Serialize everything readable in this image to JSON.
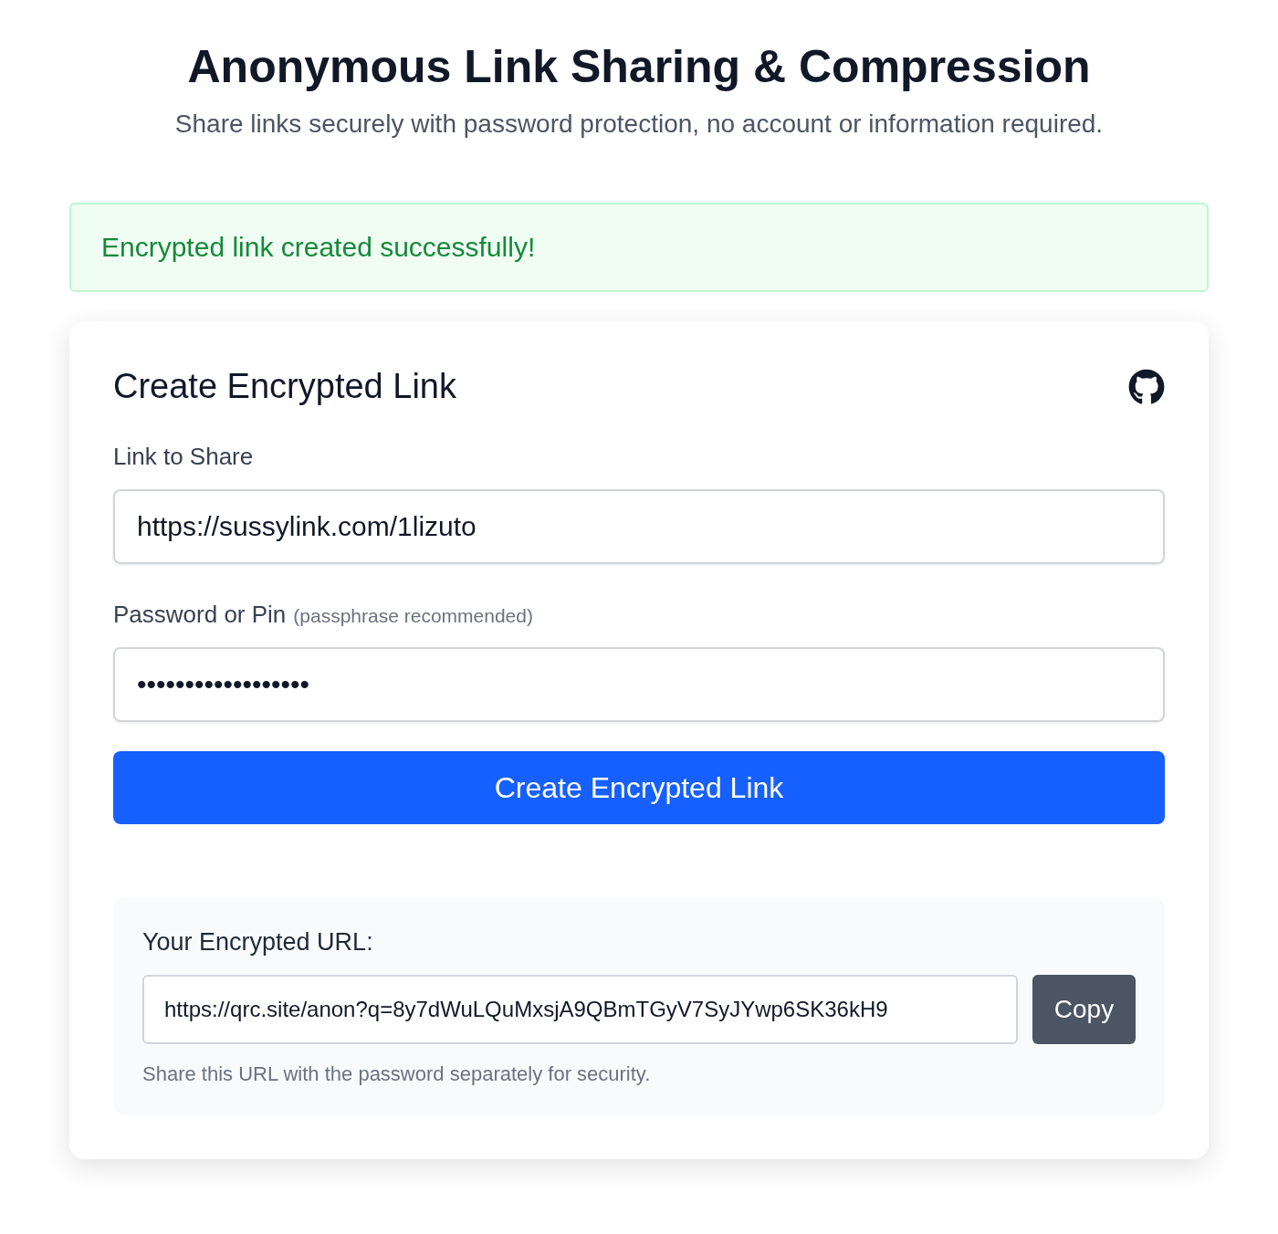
{
  "header": {
    "title": "Anonymous Link Sharing & Compression",
    "subtitle": "Share links securely with password protection, no account or information required."
  },
  "alert": {
    "kind": "success",
    "text": "Encrypted link created successfully!"
  },
  "card": {
    "title": "Create Encrypted Link",
    "fields": [
      {
        "label": "Link to Share",
        "value": "https://sussylink.com/1lizuto"
      },
      {
        "label": "Password or Pin",
        "hint": "(passphrase recommended)",
        "value": "••••••••••••••••••"
      }
    ],
    "submit": "Create Encrypted Link",
    "result": {
      "label": "Your Encrypted URL:",
      "value": "https://qrc.site/anon?q=8y7dWuLQuMxsjA9QBmTGyV7SyJYwp6SK36kH9",
      "copy": "Copy",
      "note": "Share this URL with the password separately for security."
    }
  }
}
